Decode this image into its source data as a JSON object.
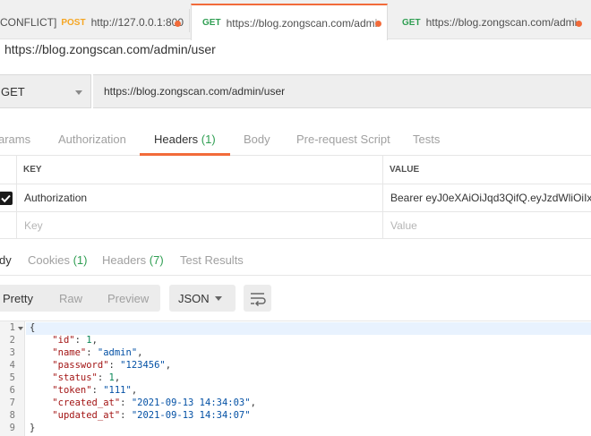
{
  "tabs": [
    {
      "prefix": "CONFLICT]",
      "method": "POST",
      "url": "http://127.0.0.1:800",
      "method_color": "#f5a623"
    },
    {
      "method": "GET",
      "url": "https://blog.zongscan.com/admi",
      "method_color": "#2f9e52"
    },
    {
      "method": "GET",
      "url": "https://blog.zongscan.com/admi",
      "method_color": "#2f9e52"
    }
  ],
  "request": {
    "title": "https://blog.zongscan.com/admin/user",
    "method": "GET",
    "url": "https://blog.zongscan.com/admin/user"
  },
  "request_tabs": {
    "params": "arams",
    "authorization": "Authorization",
    "headers": "Headers",
    "headers_count": "(1)",
    "body": "Body",
    "prerequest": "Pre-request Script",
    "tests": "Tests"
  },
  "headers_table": {
    "col_key": "KEY",
    "col_value": "VALUE",
    "rows": [
      {
        "key": "Authorization",
        "value": "Bearer eyJ0eXAiOiJqd3QifQ.eyJzdWliOiIxI",
        "checked": true
      }
    ],
    "placeholder_key": "Key",
    "placeholder_value": "Value"
  },
  "response_tabs": {
    "body": "dy",
    "cookies": "Cookies",
    "cookies_count": "(1)",
    "headers": "Headers",
    "headers_count": "(7)",
    "test_results": "Test Results"
  },
  "response_toolbar": {
    "pretty": "Pretty",
    "raw": "Raw",
    "preview": "Preview",
    "format": "JSON"
  },
  "response_body": {
    "line_numbers": [
      "1",
      "2",
      "3",
      "4",
      "5",
      "6",
      "7",
      "8",
      "9"
    ],
    "open_brace": "{",
    "close_brace": "}",
    "fields": [
      {
        "key": "\"id\"",
        "value": "1",
        "kind": "n"
      },
      {
        "key": "\"name\"",
        "value": "\"admin\"",
        "kind": "s"
      },
      {
        "key": "\"password\"",
        "value": "\"123456\"",
        "kind": "s"
      },
      {
        "key": "\"status\"",
        "value": "1",
        "kind": "n"
      },
      {
        "key": "\"token\"",
        "value": "\"111\"",
        "kind": "s"
      },
      {
        "key": "\"created_at\"",
        "value": "\"2021-09-13 14:34:03\"",
        "kind": "s"
      },
      {
        "key": "\"updated_at\"",
        "value": "\"2021-09-13 14:34:07\"",
        "kind": "s"
      }
    ]
  },
  "colors": {
    "accent": "#f26b3a",
    "get_method": "#2f9e52",
    "post_method": "#f5a623",
    "count_green": "#2f9e52"
  }
}
